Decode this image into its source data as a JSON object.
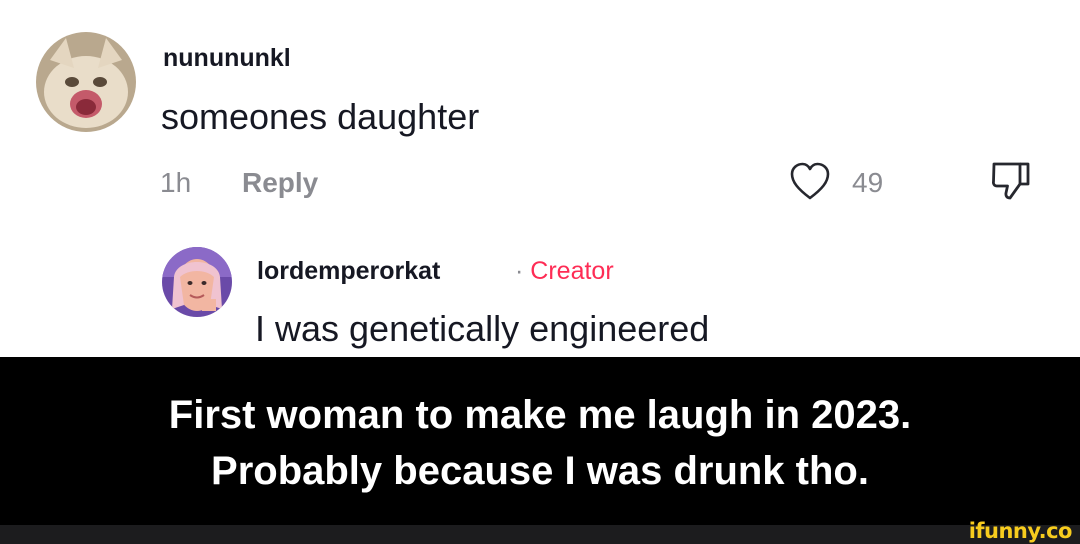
{
  "comment": {
    "username": "nunununkl",
    "text": "someones daughter",
    "time": "1h",
    "reply_label": "Reply",
    "like_count": "49",
    "like_icon": "heart-outline-icon",
    "dislike_icon": "thumbs-down-icon"
  },
  "reply": {
    "username": "lordemperorkat",
    "separator": "·",
    "badge": "Creator",
    "badge_color": "#fe2c55",
    "text": "I was genetically engineered"
  },
  "caption": {
    "line1": "First woman to make me laugh in 2023.",
    "line2": "Probably because I was drunk tho."
  },
  "watermark": {
    "text": "ifunny.co",
    "color": "#f7cc1e"
  }
}
